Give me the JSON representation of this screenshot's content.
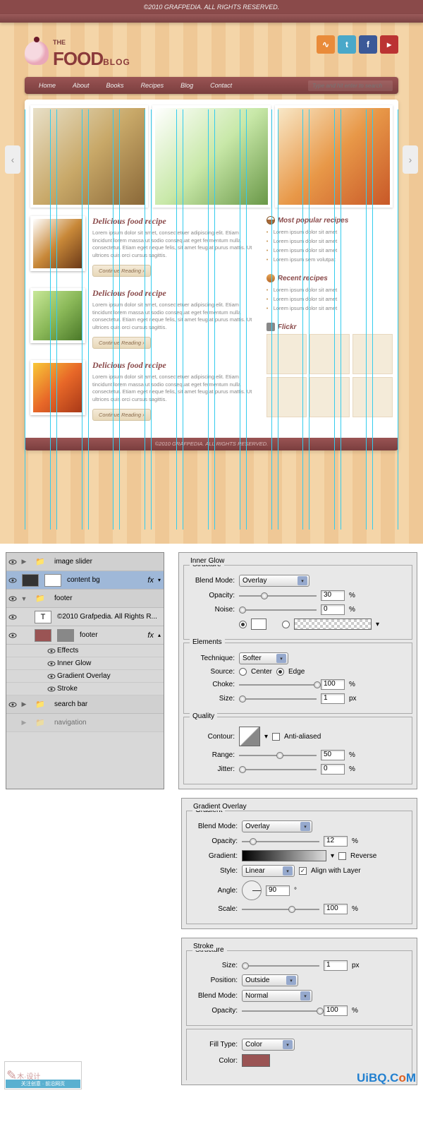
{
  "site": {
    "copyright_top": "©2010 GRAFPEDIA. ALL RIGHTS RESERVED.",
    "logo": {
      "the": "THE",
      "food": "FOOD",
      "blog": "BLOG"
    },
    "social": [
      "rss",
      "twitter",
      "facebook",
      "youtube"
    ],
    "nav": [
      "Home",
      "About",
      "Books",
      "Recipes",
      "Blog",
      "Contact"
    ],
    "search_placeholder": "Type and hit enter to search",
    "posts": [
      {
        "title": "Delicious food recipe",
        "text": "Lorem ipsum dolor sit amet, consectetuer adipiscing elit. Etiam tincidunt lorem massa ut sodio consequat eget fermentum nulla consectetur. Etiam eget neque felis, sit amet feugiat purus mattis. Ut ultrices quis orci cursus sagittis.",
        "button": "Continue Reading ›"
      },
      {
        "title": "Delicious food recipe",
        "text": "Lorem ipsum dolor sit amet, consectetuer adipiscing elit. Etiam tincidunt lorem massa ut sodio consequat eget fermentum nulla consectetur. Etiam eget neque felis, sit amet feugiat purus mattis. Ut ultrices quis orci cursus sagittis.",
        "button": "Continue Reading ›"
      },
      {
        "title": "Delicious food recipe",
        "text": "Lorem ipsum dolor sit amet, consectetuer adipiscing elit. Etiam tincidunt lorem massa ut sodio consequat eget fermentum nulla consectetur. Etiam eget neque felis, sit amet feugiat purus mattis. Ut ultrices quis orci cursus sagittis.",
        "button": "Continue Reading ›"
      }
    ],
    "widgets": {
      "popular": {
        "title": "Most popular recipes",
        "items": [
          "Lorem ipsum dolor sit amet",
          "Lorem ipsum dolor sit amet",
          "Lorem ipsum dolor sit amet",
          "Lorem ipsum sem volutpat"
        ]
      },
      "recent": {
        "title": "Recent recipes",
        "items": [
          "Lorem ipsum dolor sit amet",
          "Lorem ipsum dolor sit amet",
          "Lorem ipsum dolor sit amet"
        ]
      },
      "flickr": {
        "title": "Flickr"
      }
    },
    "footer": "©2010 GRAFPEDIA. ALL RIGHTS RESERVED."
  },
  "layers": {
    "items": [
      {
        "type": "group",
        "name": "image slider",
        "indent": 0,
        "open": false
      },
      {
        "type": "layer",
        "name": "content bg",
        "icon": "dark",
        "indent": 0,
        "fx": true,
        "sel": true
      },
      {
        "type": "group",
        "name": "footer",
        "indent": 0,
        "open": true
      },
      {
        "type": "text",
        "name": "©2010 Grafpedia. All Rights R...",
        "indent": 1
      },
      {
        "type": "layer",
        "name": "footer",
        "icon": "red",
        "icon2": "gray",
        "indent": 1,
        "fx": true,
        "open": true
      },
      {
        "type": "fx",
        "name": "Effects",
        "indent": 1
      },
      {
        "type": "fx",
        "name": "Inner Glow",
        "indent": 1
      },
      {
        "type": "fx",
        "name": "Gradient Overlay",
        "indent": 1
      },
      {
        "type": "fx",
        "name": "Stroke",
        "indent": 1
      },
      {
        "type": "group",
        "name": "search bar",
        "indent": 0,
        "open": false
      },
      {
        "type": "group",
        "name": "navigation",
        "indent": 0,
        "open": false,
        "dim": true
      }
    ]
  },
  "innerGlow": {
    "title": "Inner Glow",
    "structure": {
      "legend": "Structure",
      "blendMode": "Overlay",
      "opacity": 30,
      "noise": 0
    },
    "elements": {
      "legend": "Elements",
      "technique": "Softer",
      "source": "Edge",
      "choke": 100,
      "size": 1
    },
    "quality": {
      "legend": "Quality",
      "antiAliased": false,
      "range": 50,
      "jitter": 0
    },
    "labels": {
      "blendMode": "Blend Mode:",
      "opacity": "Opacity:",
      "noise": "Noise:",
      "technique": "Technique:",
      "source": "Source:",
      "center": "Center",
      "edge": "Edge",
      "choke": "Choke:",
      "size": "Size:",
      "contour": "Contour:",
      "anti": "Anti-aliased",
      "range": "Range:",
      "jitter": "Jitter:"
    }
  },
  "gradientOverlay": {
    "title": "Gradient Overlay",
    "gradient": {
      "legend": "Gradient",
      "blendMode": "Overlay",
      "opacity": 12,
      "reverse": false,
      "style": "Linear",
      "align": true,
      "angle": 90,
      "scale": 100
    },
    "labels": {
      "blendMode": "Blend Mode:",
      "opacity": "Opacity:",
      "gradient": "Gradient:",
      "reverse": "Reverse",
      "style": "Style:",
      "align": "Align with Layer",
      "angle": "Angle:",
      "scale": "Scale:"
    }
  },
  "stroke": {
    "title": "Stroke",
    "structure": {
      "legend": "Structure",
      "size": 1,
      "position": "Outside",
      "blendMode": "Normal",
      "opacity": 100
    },
    "fill": {
      "fillType": "Color",
      "color": "#9a5454"
    },
    "labels": {
      "size": "Size:",
      "position": "Position:",
      "blendMode": "Blend Mode:",
      "opacity": "Opacity:",
      "fillType": "Fill Type:",
      "color": "Color:"
    }
  },
  "watermark": {
    "left": "木·设计",
    "leftSub": "关注创意 · 前沿网页",
    "right": "UiBQ.CoM"
  }
}
